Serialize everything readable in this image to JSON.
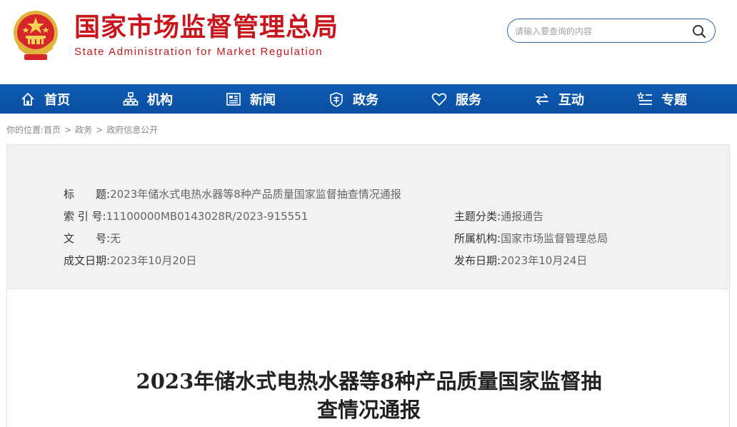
{
  "header": {
    "site_title": "国家市场监督管理总局",
    "site_subtitle": "State Administration for Market Regulation",
    "emblem_icon": "national-emblem-icon",
    "search": {
      "placeholder": "请输入要查询的内容",
      "icon": "search-icon"
    }
  },
  "colors": {
    "brand_red": "#c8161d",
    "nav_blue": "#0b55a9",
    "meta_bg": "#f2f2f2"
  },
  "nav": {
    "items": [
      {
        "label": "首页",
        "icon": "home-icon"
      },
      {
        "label": "机构",
        "icon": "org-icon"
      },
      {
        "label": "新闻",
        "icon": "news-icon"
      },
      {
        "label": "政务",
        "icon": "government-icon"
      },
      {
        "label": "服务",
        "icon": "heart-icon"
      },
      {
        "label": "互动",
        "icon": "exchange-icon"
      },
      {
        "label": "专题",
        "icon": "topic-icon"
      }
    ]
  },
  "breadcrumb": {
    "prefix": "你的位置:",
    "items": [
      "首页",
      "政务",
      "政府信息公开"
    ],
    "separator": ">"
  },
  "meta": {
    "title_label": "标　　题:",
    "title_value": "2023年储水式电热水器等8种产品质量国家监督抽查情况通报",
    "index_label": "索 引 号:",
    "index_value": "11100000MB0143028R/2023-915551",
    "doc_no_label": "文　　号:",
    "doc_no_value": "无",
    "created_label": "成文日期:",
    "created_value": "2023年10月20日",
    "category_label": "主题分类:",
    "category_value": "通报通告",
    "agency_label": "所属机构:",
    "agency_value": "国家市场监督管理总局",
    "published_label": "发布日期:",
    "published_value": "2023年10月24日"
  },
  "article": {
    "title_line1": "2023年储水式电热水器等8种产品质量国家监督抽",
    "title_line2": "查情况通报"
  }
}
